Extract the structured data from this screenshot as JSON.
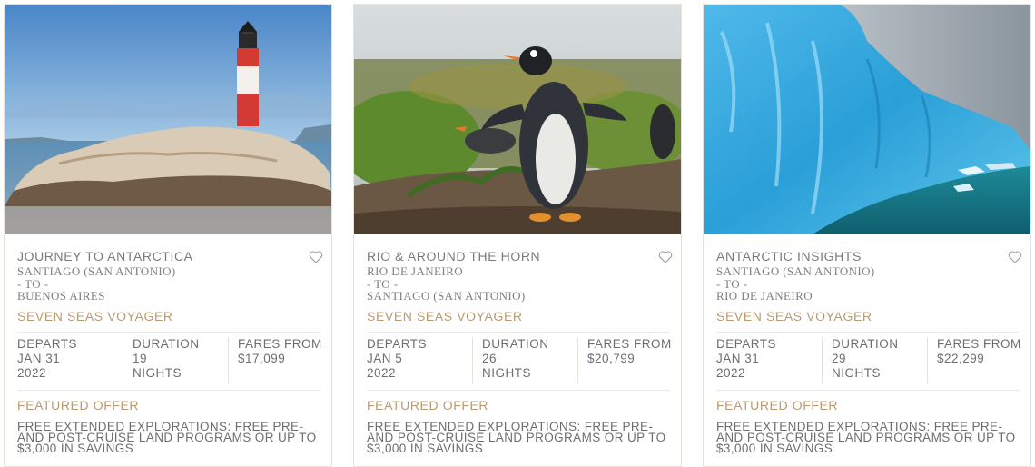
{
  "cards": [
    {
      "title": "JOURNEY TO ANTARCTICA",
      "from": "SANTIAGO (SAN ANTONIO)",
      "to_label": "- TO -",
      "to": "BUENOS AIRES",
      "ship": "SEVEN SEAS VOYAGER",
      "departs_label": "DEPARTS",
      "departs_line1": "JAN 31",
      "departs_line2": "2022",
      "duration_label": "DURATION",
      "duration_value": "19",
      "duration_unit": "NIGHTS",
      "fares_label": "FARES FROM",
      "fares_value": "$17,099",
      "offer_label": "FEATURED OFFER",
      "offer_text": "FREE EXTENDED EXPLORATIONS: FREE PRE- AND POST-CRUISE LAND PROGRAMS OR UP TO $3,000 IN SAVINGS",
      "image_icon": "lighthouse-photo"
    },
    {
      "title": "RIO & AROUND THE HORN",
      "from": "RIO DE JANEIRO",
      "to_label": "- TO -",
      "to": "SANTIAGO (SAN ANTONIO)",
      "ship": "SEVEN SEAS VOYAGER",
      "departs_label": "DEPARTS",
      "departs_line1": "JAN 5",
      "departs_line2": "2022",
      "duration_label": "DURATION",
      "duration_value": "26",
      "duration_unit": "NIGHTS",
      "fares_label": "FARES FROM",
      "fares_value": "$20,799",
      "offer_label": "FEATURED OFFER",
      "offer_text": "FREE EXTENDED EXPLORATIONS: FREE PRE- AND POST-CRUISE LAND PROGRAMS OR UP TO $3,000 IN SAVINGS",
      "image_icon": "penguin-photo"
    },
    {
      "title": "ANTARCTIC INSIGHTS",
      "from": "SANTIAGO (SAN ANTONIO)",
      "to_label": "- TO -",
      "to": "RIO DE JANEIRO",
      "ship": "SEVEN SEAS VOYAGER",
      "departs_label": "DEPARTS",
      "departs_line1": "JAN 31",
      "departs_line2": "2022",
      "duration_label": "DURATION",
      "duration_value": "29",
      "duration_unit": "NIGHTS",
      "fares_label": "FARES FROM",
      "fares_value": "$22,299",
      "offer_label": "FEATURED OFFER",
      "offer_text": "FREE EXTENDED EXPLORATIONS: FREE PRE- AND POST-CRUISE LAND PROGRAMS OR UP TO $3,000 IN SAVINGS",
      "image_icon": "glacier-photo"
    }
  ],
  "colors": {
    "accent_gold": "#b89a72",
    "text_gray": "#6e6e6e",
    "divider": "#ece8e2"
  }
}
